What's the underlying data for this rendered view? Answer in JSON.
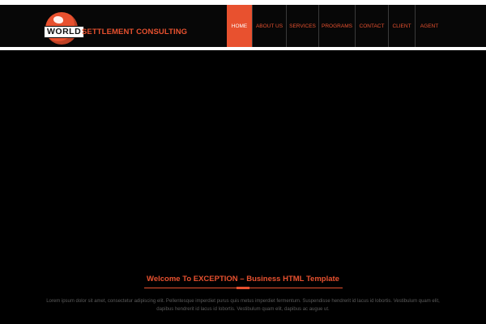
{
  "brand": {
    "badge": "WORLD",
    "name": "SETTLEMENT CONSULTING",
    "accent_color": "#e8512f"
  },
  "nav": {
    "items": [
      {
        "label": "HOME",
        "active": true
      },
      {
        "label": "ABOUT US",
        "active": false
      },
      {
        "label": "SERVICES",
        "active": false
      },
      {
        "label": "PROGRAMS",
        "active": false
      },
      {
        "label": "CONTACT",
        "active": false
      },
      {
        "label": "CLIENT",
        "active": false
      },
      {
        "label": "AGENT",
        "active": false
      }
    ]
  },
  "intro": {
    "heading": "Welcome To EXCEPTION – Business HTML Template",
    "text_line1": "Lorem ipsum dolor sit amet, consectetur adipiscing elit. Pellentesque imperdiet purus quis metus imperdiet fermentum. Suspendisse hendrerit id lacus id lobortis. Vestibulum quam elit,",
    "text_line2": "dapibus hendrerit id lacus id lobortis. Vestibulum quam elit, dapibus ac augue ut."
  }
}
